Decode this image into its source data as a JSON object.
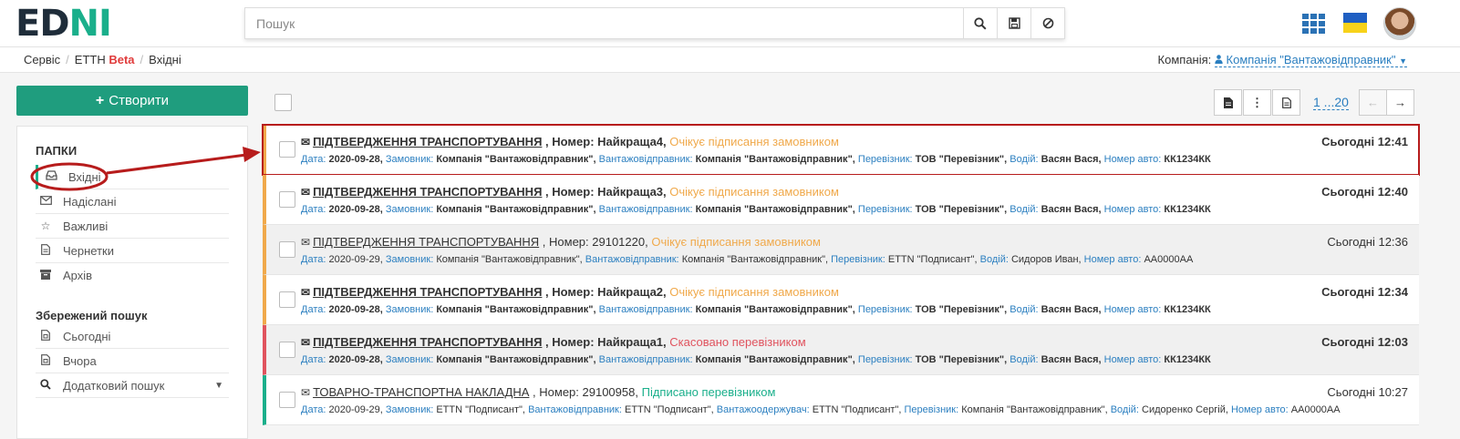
{
  "header": {
    "logo_a": "ED",
    "logo_b": "NI",
    "search_placeholder": "Пошук",
    "search_icon": "search-icon",
    "save_icon": "save-icon",
    "clear_icon": "ban-icon"
  },
  "breadcrumbs": {
    "service": "Сервіс",
    "ettn": "ЕТТН",
    "beta": "Beta",
    "current": "Вхідні"
  },
  "company": {
    "label": "Компанія:",
    "value": "Компанія \"Вантажовідправник\""
  },
  "sidebar": {
    "create": "Створити",
    "folders_title": "ПАПКИ",
    "folders": [
      {
        "label": "Вхідні",
        "icon": "inbox-icon"
      },
      {
        "label": "Надіслані",
        "icon": "envelope-icon"
      },
      {
        "label": "Важливі",
        "icon": "star-icon"
      },
      {
        "label": "Чернетки",
        "icon": "file-icon"
      },
      {
        "label": "Архів",
        "icon": "archive-icon"
      }
    ],
    "saved_title": "Збережений пошук",
    "saved": [
      {
        "label": "Сьогодні",
        "icon": "calendar-file-icon"
      },
      {
        "label": "Вчора",
        "icon": "calendar-file-icon"
      },
      {
        "label": "Додатковий пошук",
        "icon": "search-icon"
      }
    ]
  },
  "toolbar": {
    "pager": "1 ...20"
  },
  "rows": [
    {
      "title": "ПІДТВЕРДЖЕННЯ ТРАНСПОРТУВАННЯ",
      "number": "Номер: Найкраща4",
      "status": "Очікує підписання замовником",
      "time": "Сьогодні 12:41",
      "date_k": "Дата:",
      "date": "2020-09-28,",
      "c_k": "Замовник:",
      "c": "Компанія \"Вантажовідправник\",",
      "s_k": "Вантажовідправник:",
      "s": "Компанія \"Вантажовідправник\",",
      "p_k": "Перевізник:",
      "p": "ТОВ \"Перевізник\",",
      "d_k": "Водій:",
      "d": "Васян Вася,",
      "a_k": "Номер авто:",
      "a": "КК1234КК"
    },
    {
      "title": "ПІДТВЕРДЖЕННЯ ТРАНСПОРТУВАННЯ",
      "number": "Номер: Найкраща3",
      "status": "Очікує підписання замовником",
      "time": "Сьогодні 12:40",
      "date_k": "Дата:",
      "date": "2020-09-28,",
      "c_k": "Замовник:",
      "c": "Компанія \"Вантажовідправник\",",
      "s_k": "Вантажовідправник:",
      "s": "Компанія \"Вантажовідправник\",",
      "p_k": "Перевізник:",
      "p": "ТОВ \"Перевізник\",",
      "d_k": "Водій:",
      "d": "Васян Вася,",
      "a_k": "Номер авто:",
      "a": "КК1234КК"
    },
    {
      "title": "ПІДТВЕРДЖЕННЯ ТРАНСПОРТУВАННЯ",
      "number": "Номер: 29101220",
      "status": "Очікує підписання замовником",
      "time": "Сьогодні 12:36",
      "date_k": "Дата:",
      "date": "2020-09-29,",
      "c_k": "Замовник:",
      "c": "Компанія \"Вантажовідправник\",",
      "s_k": "Вантажовідправник:",
      "s": "Компанія \"Вантажовідправник\",",
      "p_k": "Перевізник:",
      "p": "ETTN \"Подписант\",",
      "d_k": "Водій:",
      "d": "Сидоров Иван,",
      "a_k": "Номер авто:",
      "a": "AA0000AA"
    },
    {
      "title": "ПІДТВЕРДЖЕННЯ ТРАНСПОРТУВАННЯ",
      "number": "Номер: Найкраща2",
      "status": "Очікує підписання замовником",
      "time": "Сьогодні 12:34",
      "date_k": "Дата:",
      "date": "2020-09-28,",
      "c_k": "Замовник:",
      "c": "Компанія \"Вантажовідправник\",",
      "s_k": "Вантажовідправник:",
      "s": "Компанія \"Вантажовідправник\",",
      "p_k": "Перевізник:",
      "p": "ТОВ \"Перевізник\",",
      "d_k": "Водій:",
      "d": "Васян Вася,",
      "a_k": "Номер авто:",
      "a": "КК1234КК"
    },
    {
      "title": "ПІДТВЕРДЖЕННЯ ТРАНСПОРТУВАННЯ",
      "number": "Номер: Найкраща1",
      "status": "Скасовано перевізником",
      "time": "Сьогодні 12:03",
      "date_k": "Дата:",
      "date": "2020-09-28,",
      "c_k": "Замовник:",
      "c": "Компанія \"Вантажовідправник\",",
      "s_k": "Вантажовідправник:",
      "s": "Компанія \"Вантажовідправник\",",
      "p_k": "Перевізник:",
      "p": "ТОВ \"Перевізник\",",
      "d_k": "Водій:",
      "d": "Васян Вася,",
      "a_k": "Номер авто:",
      "a": "КК1234КК"
    },
    {
      "title": "ТОВАРНО-ТРАНСПОРТНА НАКЛАДНА",
      "number": "Номер: 29100958",
      "status": "Підписано перевізником",
      "time": "Сьогодні 10:27",
      "date_k": "Дата:",
      "date": "2020-09-29,",
      "c_k": "Замовник:",
      "c": "ETTN \"Подписант\",",
      "s_k": "Вантажовідправник:",
      "s": "ETTN \"Подписант\",",
      "r_k": "Вантажоодержувач:",
      "r": "ETTN \"Подписант\",",
      "p_k": "Перевізник:",
      "p": "Компанія \"Вантажовідправник\",",
      "d_k": "Водій:",
      "d": "Сидоренко Сергій,",
      "a_k": "Номер авто:",
      "a": "AA0000AA"
    }
  ],
  "colors": {
    "accent": "#1f9d7e",
    "link": "#2b7fc0",
    "pending": "#f0a94b",
    "cancelled": "#e0535e",
    "signed": "#1aaf8b",
    "annotation": "#b71c1c"
  }
}
